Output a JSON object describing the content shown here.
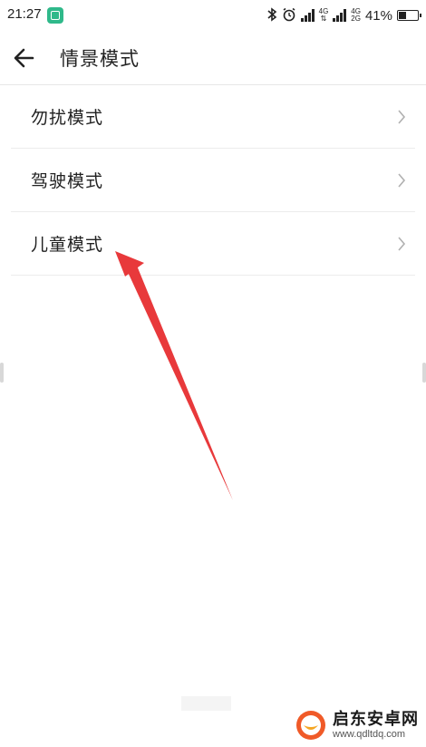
{
  "status_bar": {
    "time": "21:27",
    "battery_text": "41%",
    "battery_level": 0.41,
    "net_top": "4G",
    "net_bottom": "2G",
    "net_left_top": "4G",
    "icons": [
      "app-notification-icon",
      "bluetooth-icon",
      "alarm-icon",
      "signal-icon",
      "battery-icon"
    ]
  },
  "header": {
    "title": "情景模式",
    "back_icon": "arrow-left-icon"
  },
  "list": {
    "items": [
      {
        "label": "勿扰模式",
        "icon": "chevron-right-icon"
      },
      {
        "label": "驾驶模式",
        "icon": "chevron-right-icon"
      },
      {
        "label": "儿童模式",
        "icon": "chevron-right-icon"
      }
    ]
  },
  "annotation": {
    "color": "#e8393b",
    "icon": "annotation-arrow-icon"
  },
  "watermark": {
    "name": "启东安卓网",
    "url": "www.qdltdq.com",
    "brand_color": "#f05a28"
  },
  "colors": {
    "text": "#222222",
    "divider": "#ececec",
    "chevron": "#b0b0b0",
    "app_icon": "#2fb98a"
  }
}
